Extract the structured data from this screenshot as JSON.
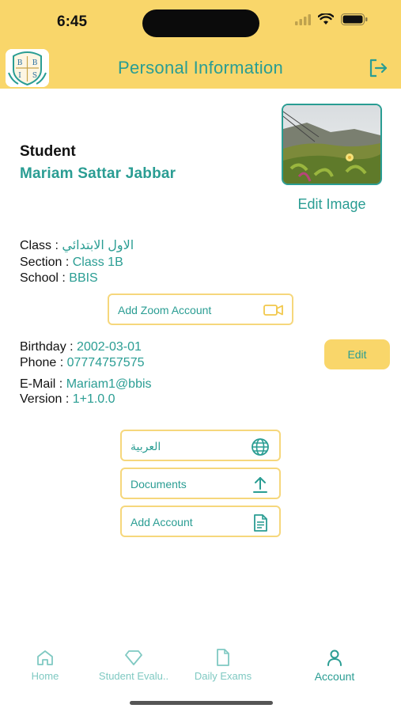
{
  "status": {
    "time": "6:45"
  },
  "header": {
    "title": "Personal Information"
  },
  "profile": {
    "role": "Student",
    "name": "Mariam Sattar Jabbar",
    "edit_image_label": "Edit Image"
  },
  "school_info": {
    "class_label": "Class",
    "class_value": "الاول الابتدائي",
    "section_label": "Section",
    "section_value": "Class 1B",
    "school_label": "School",
    "school_value": "BBIS"
  },
  "zoom": {
    "label": "Add Zoom Account"
  },
  "personal": {
    "birthday_label": "Birthday",
    "birthday_value": "2002-03-01",
    "phone_label": "Phone",
    "phone_value": "07774757575",
    "email_label": "E-Mail",
    "email_value": "Mariam1@bbis",
    "version_label": "Version",
    "version_value": "1+1.0.0",
    "edit_label": "Edit"
  },
  "actions": [
    {
      "label": "العربية",
      "icon": "globe-icon"
    },
    {
      "label": "Documents",
      "icon": "upload-icon"
    },
    {
      "label": "Add Account",
      "icon": "document-icon"
    }
  ],
  "tabs": [
    {
      "label": "Home",
      "icon": "home-icon",
      "active": false
    },
    {
      "label": "Student Evalu..",
      "icon": "diamond-icon",
      "active": false
    },
    {
      "label": "Daily Exams",
      "icon": "file-icon",
      "active": false
    },
    {
      "label": "Account",
      "icon": "person-icon",
      "active": true
    }
  ],
  "colors": {
    "accent": "#2a9d93",
    "brand_yellow": "#f9d66a",
    "button_border": "#f6d77c"
  }
}
